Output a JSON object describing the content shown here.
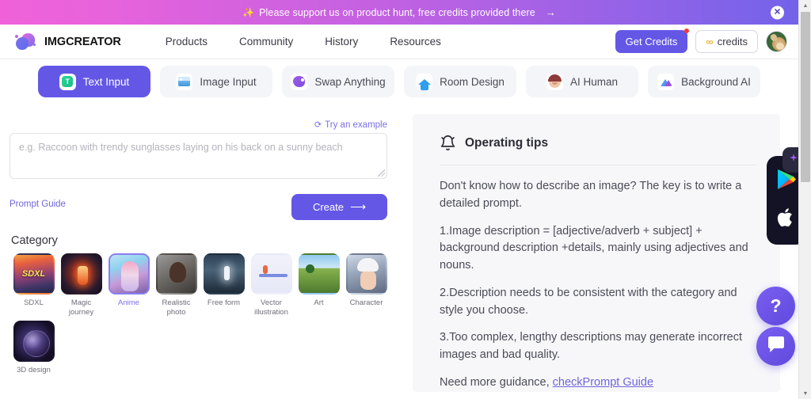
{
  "banner": {
    "sparkle_icon": "sparkles-icon",
    "text": "Please support us on product hunt, free credits provided there",
    "arrow": "→",
    "close_label": "✕",
    "gradient_from": "#f061d9",
    "gradient_to": "#7263e9"
  },
  "header": {
    "brand": "IMGCREATOR",
    "nav": [
      {
        "label": "Products"
      },
      {
        "label": "Community"
      },
      {
        "label": "History"
      },
      {
        "label": "Resources"
      }
    ],
    "get_credits_label": "Get Credits",
    "credits_symbol": "∞",
    "credits_label": "credits",
    "accent": "#6457e6"
  },
  "tabs": [
    {
      "label": "Text Input",
      "icon": "text-input-icon",
      "glyph": "T",
      "active": true
    },
    {
      "label": "Image Input",
      "icon": "image-input-icon",
      "active": false
    },
    {
      "label": "Swap Anything",
      "icon": "swap-anything-icon",
      "active": false
    },
    {
      "label": "Room Design",
      "icon": "room-design-icon",
      "active": false
    },
    {
      "label": "AI Human",
      "icon": "ai-human-icon",
      "active": false
    },
    {
      "label": "Background AI",
      "icon": "background-ai-icon",
      "active": false
    }
  ],
  "editor": {
    "try_example_label": "Try an example",
    "try_example_icon": "refresh-icon",
    "prompt_value": "",
    "prompt_placeholder": "e.g. Raccoon with trendy sunglasses laying on his back on a sunny beach",
    "prompt_guide_label": "Prompt Guide",
    "create_label": "Create",
    "create_arrow": "⟶"
  },
  "category": {
    "title": "Category",
    "items": [
      {
        "label": "SDXL",
        "thumb": "th-sdxl",
        "selected": false
      },
      {
        "label": "Magic journey",
        "thumb": "th-magic",
        "selected": false
      },
      {
        "label": "Anime",
        "thumb": "th-anime",
        "selected": true
      },
      {
        "label": "Realistic photo",
        "thumb": "th-real",
        "selected": false
      },
      {
        "label": "Free form",
        "thumb": "th-free",
        "selected": false
      },
      {
        "label": "Vector illustration",
        "thumb": "th-vector",
        "selected": false
      },
      {
        "label": "Art",
        "thumb": "th-art",
        "selected": false
      },
      {
        "label": "Character",
        "thumb": "th-char",
        "selected": false
      },
      {
        "label": "3D design",
        "thumb": "th-3d",
        "selected": false
      }
    ]
  },
  "tips": {
    "icon": "bell-icon",
    "title": "Operating tips",
    "paragraphs": [
      "Don't know how to describe an image? The key is to write a detailed prompt.",
      "1.Image description = [adjective/adverb + subject] + background description +details, mainly using adjectives and nouns.",
      "2.Description needs to be consistent with the category and style you choose.",
      "3.Too complex, lengthy descriptions may generate incorrect images and bad quality."
    ],
    "footer_prefix": "Need more guidance, ",
    "footer_link": "checkPrompt Guide"
  },
  "floating": {
    "app_badge_icons": [
      "google-play-icon",
      "apple-icon"
    ],
    "sparkle_badge_icon": "sparkles-badge-icon",
    "help_fab_label": "?",
    "chat_fab_icon": "chat-bubble-icon"
  },
  "scrollbar": {
    "up_arrow": "▲",
    "down_arrow": "▼"
  }
}
